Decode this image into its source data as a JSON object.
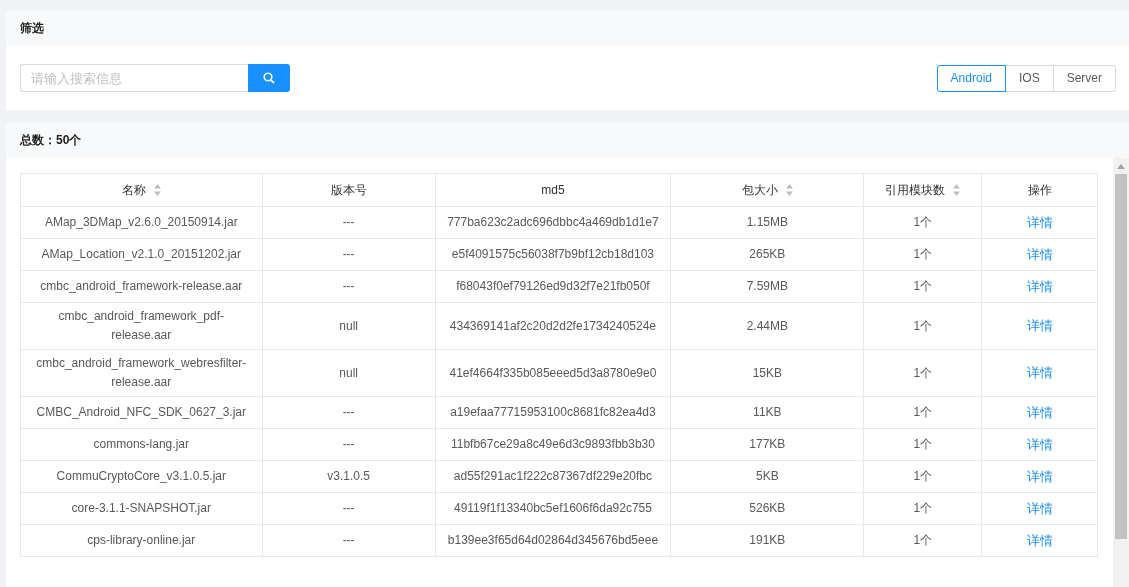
{
  "filter": {
    "title": "筛选",
    "search": {
      "placeholder": "请输入搜索信息"
    },
    "platforms": [
      {
        "label": "Android",
        "selected": true
      },
      {
        "label": "IOS",
        "selected": false
      },
      {
        "label": "Server",
        "selected": false
      }
    ]
  },
  "summary": {
    "title": "总数：50个"
  },
  "table": {
    "columns": [
      {
        "label": "名称",
        "sortable": true
      },
      {
        "label": "版本号",
        "sortable": false
      },
      {
        "label": "md5",
        "sortable": false
      },
      {
        "label": "包大小",
        "sortable": true
      },
      {
        "label": "引用模块数",
        "sortable": true
      },
      {
        "label": "操作",
        "sortable": false
      }
    ],
    "rows": [
      [
        "AMap_3DMap_v2.6.0_20150914.jar",
        "---",
        "777ba623c2adc696dbbc4a469db1d1e7",
        "1.15MB",
        "1个",
        "详情"
      ],
      [
        "AMap_Location_v2.1.0_20151202.jar",
        "---",
        "e5f4091575c56038f7b9bf12cb18d103",
        "265KB",
        "1个",
        "详情"
      ],
      [
        "cmbc_android_framework-release.aar",
        "---",
        "f68043f0ef79126ed9d32f7e21fb050f",
        "7.59MB",
        "1个",
        "详情"
      ],
      [
        "cmbc_android_framework_pdf-release.aar",
        "null",
        "434369141af2c20d2d2fe1734240524e",
        "2.44MB",
        "1个",
        "详情"
      ],
      [
        "cmbc_android_framework_webresfilter-release.aar",
        "null",
        "41ef4664f335b085eeed5d3a8780e9e0",
        "15KB",
        "1个",
        "详情"
      ],
      [
        "CMBC_Android_NFC_SDK_0627_3.jar",
        "---",
        "a19efaa77715953100c8681fc82ea4d3",
        "11KB",
        "1个",
        "详情"
      ],
      [
        "commons-lang.jar",
        "---",
        "11bfb67ce29a8c49e6d3c9893fbb3b30",
        "177KB",
        "1个",
        "详情"
      ],
      [
        "CommuCryptoCore_v3.1.0.5.jar",
        "v3.1.0.5",
        "ad55f291ac1f222c87367df229e20fbc",
        "5KB",
        "1个",
        "详情"
      ],
      [
        "core-3.1.1-SNAPSHOT.jar",
        "---",
        "49119f1f13340bc5ef1606f6da92c755",
        "526KB",
        "1个",
        "详情"
      ],
      [
        "cps-library-online.jar",
        "---",
        "b139ee3f65d64d02864d345676bd5eee",
        "191KB",
        "1个",
        "详情"
      ]
    ]
  }
}
